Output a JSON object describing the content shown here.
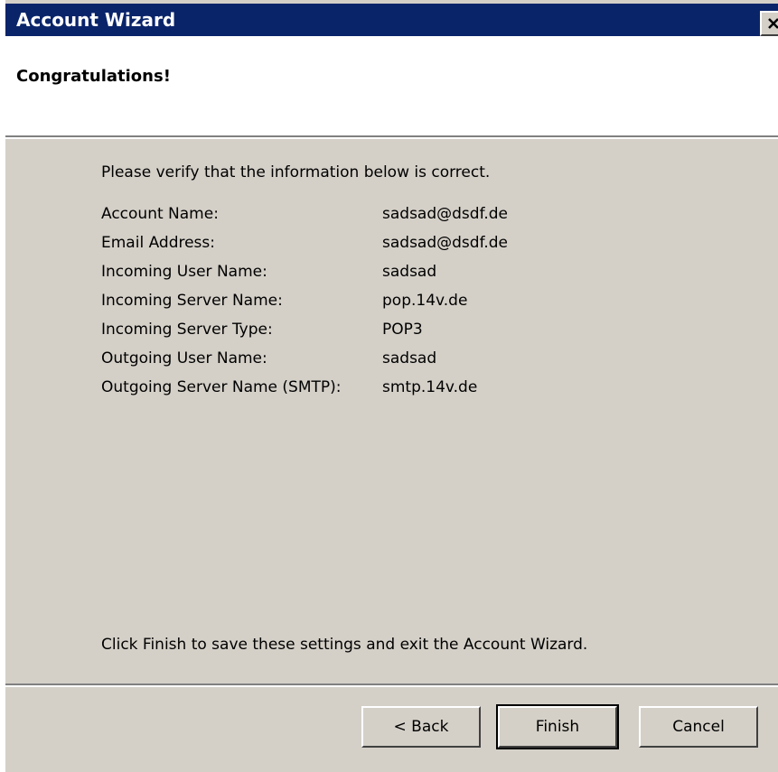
{
  "window": {
    "title": "Account Wizard",
    "close_icon": "close-icon"
  },
  "header": {
    "heading": "Congratulations!"
  },
  "content": {
    "intro": "Please verify that the information below is correct.",
    "rows": [
      {
        "label": "Account Name:",
        "value": "sadsad@dsdf.de"
      },
      {
        "label": "Email Address:",
        "value": "sadsad@dsdf.de"
      },
      {
        "label": "Incoming User Name:",
        "value": "sadsad"
      },
      {
        "label": "Incoming Server Name:",
        "value": "pop.14v.de"
      },
      {
        "label": "Incoming Server Type:",
        "value": "POP3"
      },
      {
        "label": "Outgoing User Name:",
        "value": "sadsad"
      },
      {
        "label": "Outgoing Server Name (SMTP):",
        "value": "smtp.14v.de"
      }
    ],
    "finish_note": "Click Finish to save these settings and exit the Account Wizard."
  },
  "buttons": {
    "back": "< Back",
    "finish": "Finish",
    "cancel": "Cancel"
  },
  "colors": {
    "titlebar": "#0a246a",
    "dialog_background": "#d4d0c8",
    "header_background": "#ffffff"
  }
}
